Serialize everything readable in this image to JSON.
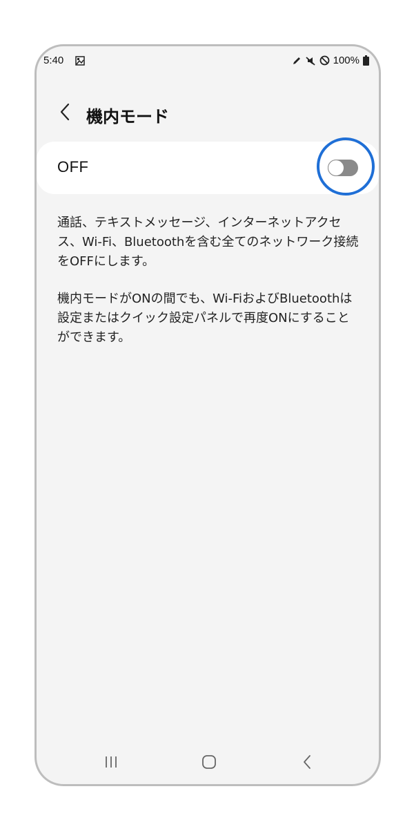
{
  "status_bar": {
    "time": "5:40",
    "battery": "100%"
  },
  "header": {
    "title": "機内モード"
  },
  "airplane_mode": {
    "state_label": "OFF",
    "enabled": false
  },
  "description": {
    "paragraph_1": "通話、テキストメッセージ、インターネットアクセス、Wi-Fi、Bluetoothを含む全てのネットワーク接続をOFFにします。",
    "paragraph_2": "機内モードがONの間でも、Wi-FiおよびBluetoothは設定またはクイック設定パネルで再度ONにすることができます。"
  },
  "icons": {
    "back": "chevron-left-icon",
    "recent_apps": "recent-apps-icon",
    "home": "home-icon",
    "nav_back": "nav-back-icon",
    "status_left": "gallery-icon",
    "status_right": [
      "pen-icon",
      "mute-icon",
      "do-not-disturb-icon",
      "battery-icon"
    ]
  },
  "colors": {
    "highlight": "#1f6fd6",
    "background": "#f4f4f4",
    "card": "#ffffff",
    "switch_off": "#8a8a8a"
  }
}
